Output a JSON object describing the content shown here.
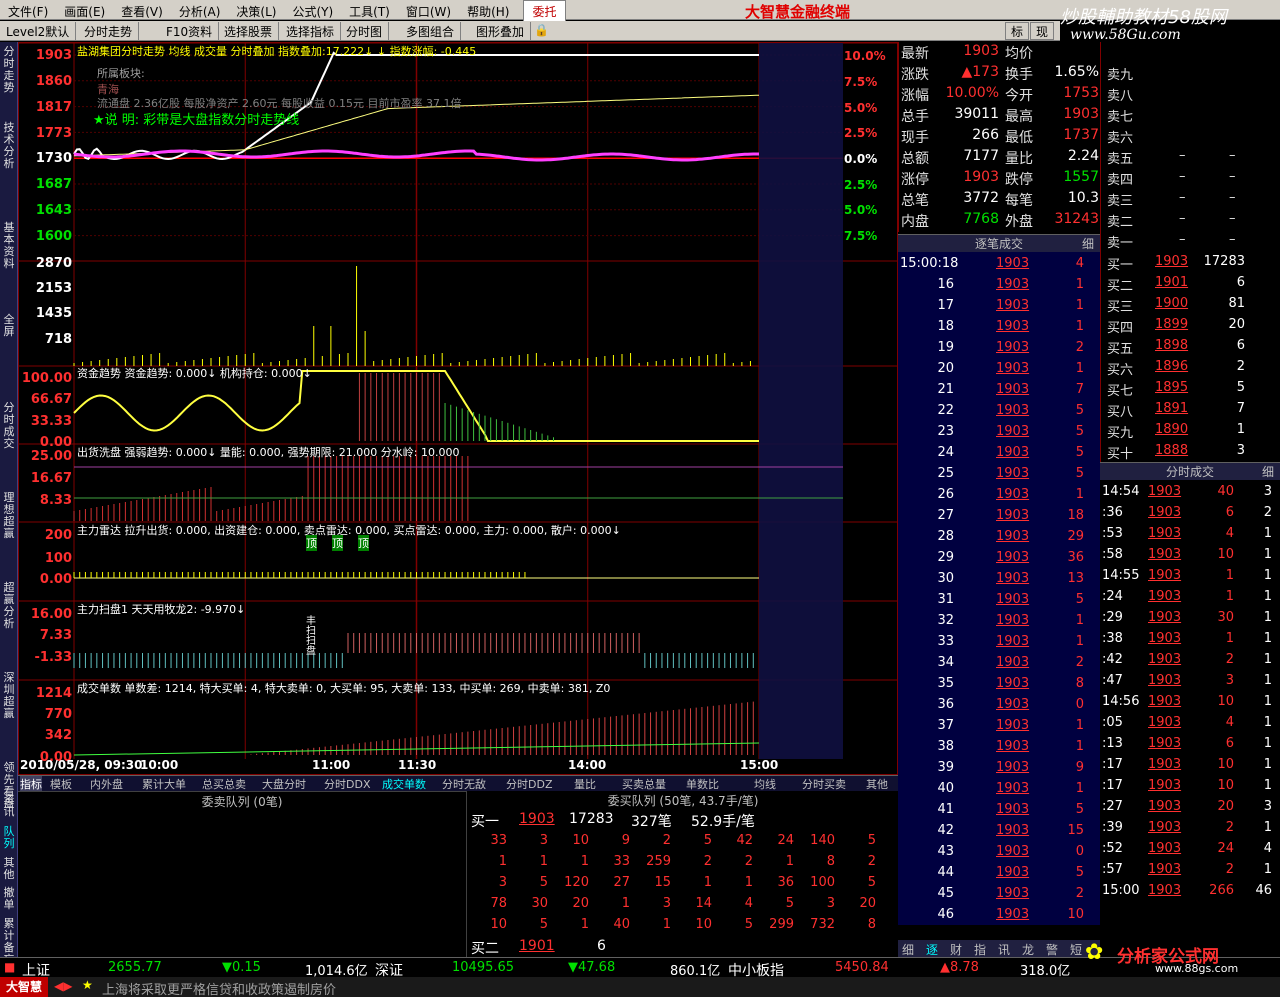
{
  "menu": [
    "文件(F)",
    "画面(E)",
    "查看(V)",
    "分析(A)",
    "决策(L)",
    "公式(Y)",
    "工具(T)",
    "窗口(W)",
    "帮助(H)",
    "委托"
  ],
  "brand": "大智慧金融终端",
  "watermark": "炒股輔助教材58股网",
  "watermark_url": "www.58Gu.com",
  "toolbar": [
    "Level2默认",
    "分时走势",
    "F10资料",
    "选择股票",
    "选择指标",
    "分时图",
    "多图组合",
    "图形叠加"
  ],
  "toolbar_right": [
    "标",
    "现"
  ],
  "leftbar": [
    "分时走势",
    "技术分析",
    "基本资料",
    "全屏",
    "分时成交",
    "理想超赢",
    "超赢分析",
    "深圳超赢",
    "领先看盘",
    "资讯",
    "队列",
    "其他",
    "撤单",
    "累计",
    "备忘"
  ],
  "chart": {
    "title_line": "盐湖集团分时走势 均线 成交量 分时叠加 指数叠加:17.222↓ ↓ 指数涨幅: -0.445",
    "info_block": "所属板块:",
    "info_region": "青海",
    "info_line": "流通盘 2.36亿股 每股净资产 2.60元 每股收益 0.15元 目前市盈率 37.1倍",
    "note": "★说 明: 彩带是大盘指数分时走势线",
    "y_left": [
      "1903",
      "1860",
      "1817",
      "1773",
      "1730",
      "1687",
      "1643",
      "1600"
    ],
    "y_right": [
      "10.0%",
      "7.5%",
      "5.0%",
      "2.5%",
      "0.0%",
      "2.5%",
      "5.0%",
      "7.5%"
    ],
    "vol_left": [
      "2870",
      "2153",
      "1435",
      "718"
    ],
    "money_title": "资金趋势  资金趋势: 0.000↓  机构持仓: 0.000↓",
    "money_left": [
      "100.00",
      "66.67",
      "33.33",
      "0.00"
    ],
    "wash_title": "出货洗盘  强弱趋势: 0.000↓  量能: 0.000, 强势期限: 21.000  分水岭: 10.000",
    "wash_left": [
      "25.00",
      "16.67",
      "8.33"
    ],
    "radar_title": "主力雷达  拉升出货: 0.000, 出资建仓: 0.000, 卖点雷达: 0.000, 买点雷达: 0.000, 主力: 0.000, 散户: 0.000↓",
    "radar_left": [
      "200",
      "100",
      "0.00"
    ],
    "radar_marks": [
      "顶",
      "顶",
      "顶"
    ],
    "sweep_title": "主力扫盘1  天天用牧龙2: -9.970↓",
    "sweep_left": [
      "16.00",
      "7.33",
      "-1.33"
    ],
    "sweep_marks": [
      "丰",
      "扫",
      "扫",
      "盘"
    ],
    "orders_title": "成交单数  单数差: 1214, 特大买单: 4, 特大卖单: 0, 大买单: 95, 大卖单: 133, 中买单: 269, 中卖单: 381, Z0",
    "orders_left": [
      "1214",
      "770",
      "342",
      "0.00"
    ],
    "x_labels": [
      "2010/05/28, 09:30",
      "10:00",
      "11:00",
      "11:30",
      "14:00",
      "15:00"
    ]
  },
  "tabs": [
    "指标",
    "模板",
    "内外盘",
    "累计大单",
    "总买总卖",
    "大盘分时",
    "分时DDX",
    "成交单数",
    "分时无敌",
    "分时DDZ",
    "量比",
    "买卖总量",
    "单数比",
    "均线",
    "分时买卖",
    "其他"
  ],
  "quote": [
    {
      "l": "最新",
      "v": "1903",
      "vc": "red",
      "l2": "均价",
      "v2": "",
      "v2c": "red"
    },
    {
      "l": "涨跌",
      "v": "▲173",
      "vc": "red",
      "l2": "换手",
      "v2": "1.65%",
      "v2c": "wht"
    },
    {
      "l": "涨幅",
      "v": "10.00%",
      "vc": "red",
      "l2": "今开",
      "v2": "1753",
      "v2c": "red"
    },
    {
      "l": "总手",
      "v": "39011",
      "vc": "wht",
      "l2": "最高",
      "v2": "1903",
      "v2c": "red"
    },
    {
      "l": "现手",
      "v": "266",
      "vc": "wht",
      "l2": "最低",
      "v2": "1737",
      "v2c": "red"
    },
    {
      "l": "总额",
      "v": "7177",
      "vc": "wht",
      "l2": "量比",
      "v2": "2.24",
      "v2c": "wht"
    },
    {
      "l": "涨停",
      "v": "1903",
      "vc": "red",
      "l2": "跌停",
      "v2": "1557",
      "v2c": "grn"
    },
    {
      "l": "总笔",
      "v": "3772",
      "vc": "wht",
      "l2": "每笔",
      "v2": "10.3",
      "v2c": "wht"
    },
    {
      "l": "内盘",
      "v": "7768",
      "vc": "grn",
      "l2": "外盘",
      "v2": "31243",
      "v2c": "red"
    }
  ],
  "sells": [
    {
      "l": "卖九",
      "p": "",
      "v": ""
    },
    {
      "l": "卖八",
      "p": "",
      "v": ""
    },
    {
      "l": "卖七",
      "p": "",
      "v": ""
    },
    {
      "l": "卖六",
      "p": "",
      "v": ""
    },
    {
      "l": "卖五",
      "p": "–",
      "v": "–"
    },
    {
      "l": "卖四",
      "p": "–",
      "v": "–"
    },
    {
      "l": "卖三",
      "p": "–",
      "v": "–"
    },
    {
      "l": "卖二",
      "p": "–",
      "v": "–"
    },
    {
      "l": "卖一",
      "p": "–",
      "v": "–"
    }
  ],
  "buys": [
    {
      "l": "买一",
      "p": "1903",
      "v": "17283"
    },
    {
      "l": "买二",
      "p": "1901",
      "v": "6"
    },
    {
      "l": "买三",
      "p": "1900",
      "v": "81"
    },
    {
      "l": "买四",
      "p": "1899",
      "v": "20"
    },
    {
      "l": "买五",
      "p": "1898",
      "v": "6"
    },
    {
      "l": "买六",
      "p": "1896",
      "v": "2"
    },
    {
      "l": "买七",
      "p": "1895",
      "v": "5"
    },
    {
      "l": "买八",
      "p": "1891",
      "v": "7"
    },
    {
      "l": "买九",
      "p": "1890",
      "v": "1"
    },
    {
      "l": "买十",
      "p": "1888",
      "v": "3"
    }
  ],
  "tick_head": "逐笔成交",
  "tick_head_right": "细",
  "ticks": [
    [
      "15:00:18",
      "1903",
      "4"
    ],
    [
      "16",
      "1903",
      "1"
    ],
    [
      "17",
      "1903",
      "1"
    ],
    [
      "18",
      "1903",
      "1"
    ],
    [
      "19",
      "1903",
      "2"
    ],
    [
      "20",
      "1903",
      "1"
    ],
    [
      "21",
      "1903",
      "7"
    ],
    [
      "22",
      "1903",
      "5"
    ],
    [
      "23",
      "1903",
      "5"
    ],
    [
      "24",
      "1903",
      "5"
    ],
    [
      "25",
      "1903",
      "5"
    ],
    [
      "26",
      "1903",
      "1"
    ],
    [
      "27",
      "1903",
      "18"
    ],
    [
      "28",
      "1903",
      "29"
    ],
    [
      "29",
      "1903",
      "36"
    ],
    [
      "30",
      "1903",
      "13"
    ],
    [
      "31",
      "1903",
      "5"
    ],
    [
      "32",
      "1903",
      "1"
    ],
    [
      "33",
      "1903",
      "1"
    ],
    [
      "34",
      "1903",
      "2"
    ],
    [
      "35",
      "1903",
      "8"
    ],
    [
      "36",
      "1903",
      "0"
    ],
    [
      "37",
      "1903",
      "1"
    ],
    [
      "38",
      "1903",
      "1"
    ],
    [
      "39",
      "1903",
      "9"
    ],
    [
      "40",
      "1903",
      "1"
    ],
    [
      "41",
      "1903",
      "5"
    ],
    [
      "42",
      "1903",
      "15"
    ],
    [
      "43",
      "1903",
      "0"
    ],
    [
      "44",
      "1903",
      "5"
    ],
    [
      "45",
      "1903",
      "2"
    ],
    [
      "46",
      "1903",
      "10"
    ]
  ],
  "tick_tabs": [
    "细",
    "逐",
    "财",
    "指",
    "讯",
    "龙",
    "警",
    "短"
  ],
  "rt_head": "分时成交",
  "rt_head_right": "细",
  "rticks": [
    [
      "14:54",
      "1903",
      "40",
      "3"
    ],
    [
      ":36",
      "1903",
      "6",
      "2"
    ],
    [
      ":53",
      "1903",
      "4",
      "1"
    ],
    [
      ":58",
      "1903",
      "10",
      "1"
    ],
    [
      "14:55",
      "1903",
      "1",
      "1"
    ],
    [
      ":24",
      "1903",
      "1",
      "1"
    ],
    [
      ":29",
      "1903",
      "30",
      "1"
    ],
    [
      ":38",
      "1903",
      "1",
      "1"
    ],
    [
      ":42",
      "1903",
      "2",
      "1"
    ],
    [
      ":47",
      "1903",
      "3",
      "1"
    ],
    [
      "14:56",
      "1903",
      "10",
      "1"
    ],
    [
      ":05",
      "1903",
      "4",
      "1"
    ],
    [
      ":13",
      "1903",
      "6",
      "1"
    ],
    [
      ":17",
      "1903",
      "10",
      "1"
    ],
    [
      ":17",
      "1903",
      "10",
      "1"
    ],
    [
      ":27",
      "1903",
      "20",
      "3"
    ],
    [
      ":39",
      "1903",
      "2",
      "1"
    ],
    [
      ":52",
      "1903",
      "24",
      "4"
    ],
    [
      ":57",
      "1903",
      "2",
      "1"
    ],
    [
      "15:00",
      "1903",
      "266",
      "46"
    ]
  ],
  "queue_left_title": "委卖队列 (0笔)",
  "queue_right_title": "委买队列 (50笔, 43.7手/笔)",
  "queue_buy1": {
    "l": "买一",
    "p": "1903",
    "v": "17283",
    "n": "327笔",
    "a": "52.9手/笔"
  },
  "queue_rows": [
    [
      "33",
      "3",
      "10",
      "9",
      "2",
      "5",
      "42",
      "24",
      "140",
      "5"
    ],
    [
      "1",
      "1",
      "1",
      "33",
      "259",
      "2",
      "2",
      "1",
      "8",
      "2"
    ],
    [
      "3",
      "5",
      "120",
      "27",
      "15",
      "1",
      "1",
      "36",
      "100",
      "5"
    ],
    [
      "78",
      "30",
      "20",
      "1",
      "3",
      "14",
      "4",
      "5",
      "3",
      "20"
    ],
    [
      "10",
      "5",
      "1",
      "40",
      "1",
      "10",
      "5",
      "299",
      "732",
      "8"
    ]
  ],
  "queue_buy2": {
    "l": "买二",
    "p": "1901",
    "v": "6"
  },
  "status": {
    "sh_label": "上证",
    "sh_val": "2655.77",
    "sh_chg": "▼0.15",
    "sh_amt": "1,014.6亿",
    "sz_label": "深证",
    "sz_val": "10495.65",
    "sz_chg": "▼47.68",
    "sz_amt": "860.1亿",
    "zx_label": "中小板指",
    "zx_val": "5450.84",
    "zx_chg": "▲8.78",
    "zx_amt": "318.0亿"
  },
  "ticker": "上海将采取更严格信贷和收政策遏制房价",
  "logo_small": "大智慧",
  "logo_bottom": "分析家公式网",
  "logo_bottom_url": "www.88gs.com",
  "colors": {
    "up": "#ff3030",
    "down": "#00e000",
    "bg": "#000000",
    "grid": "#800000"
  }
}
